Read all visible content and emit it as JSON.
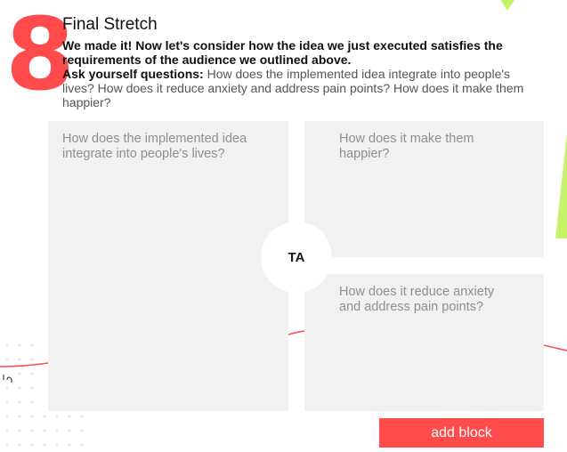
{
  "step": {
    "number": "8"
  },
  "header": {
    "title": "Final Stretch",
    "lead": "We made it! Now let's consider how the idea we just executed satisfies the requirements of the audience we outlined above.",
    "ask_label": "Ask yourself questions:",
    "ask_text": " How does the implemented idea integrate into people's lives? How does it reduce anxiety and address pain points? How does it make them happier?"
  },
  "cards": {
    "left": "How does the implemented idea integrate into people's lives?",
    "top_right": "How does it make them happier?",
    "bottom_right": "How does it reduce anxiety and address pain points?"
  },
  "avatar": {
    "initials": "TA"
  },
  "actions": {
    "add_block_label": "add block"
  },
  "colors": {
    "accent": "#ff4b4b",
    "lime": "#c6f26a",
    "card": "#f1f1f1"
  }
}
